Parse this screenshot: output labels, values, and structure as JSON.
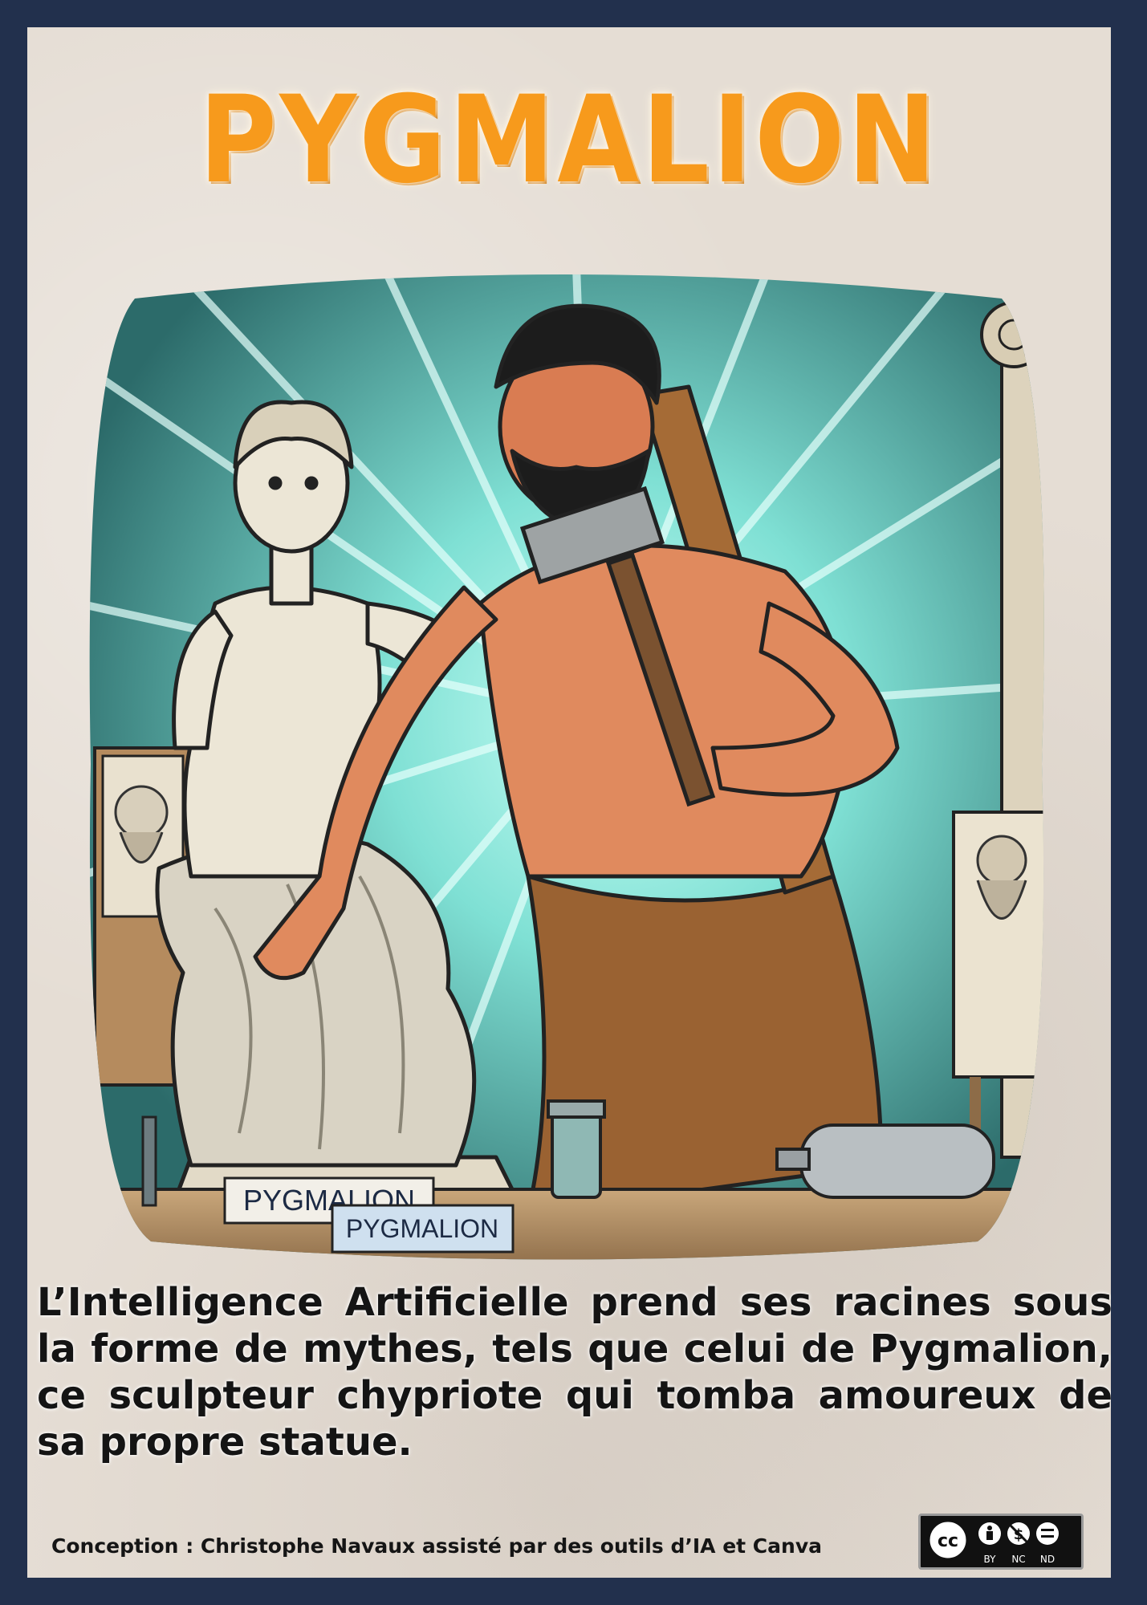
{
  "title": "PYGMALION",
  "illustration": {
    "plaque_back": "PYGMALION",
    "plaque_front": "PYGMALION"
  },
  "caption": "L’Intelligence Artificielle prend ses racines sous la forme de mythes, tels que celui de Pygmalion, ce sculpteur chypriote qui tomba amoureux de sa propre statue.",
  "credit": "Conception : Christophe Navaux  assisté par des outils d’IA et Canva",
  "license": {
    "icon": "cc-by-nc-nd-icon",
    "cc_mark": "cc",
    "by": "BY",
    "nc": "NC",
    "nd": "ND"
  },
  "colors": {
    "frame": "#22304d",
    "card": "#e5ddd4",
    "title": "#f79a1c",
    "rays": "#5fd4c8",
    "skin": "#e08a5e",
    "apron": "#9a6232",
    "marble": "#ece6d6"
  }
}
